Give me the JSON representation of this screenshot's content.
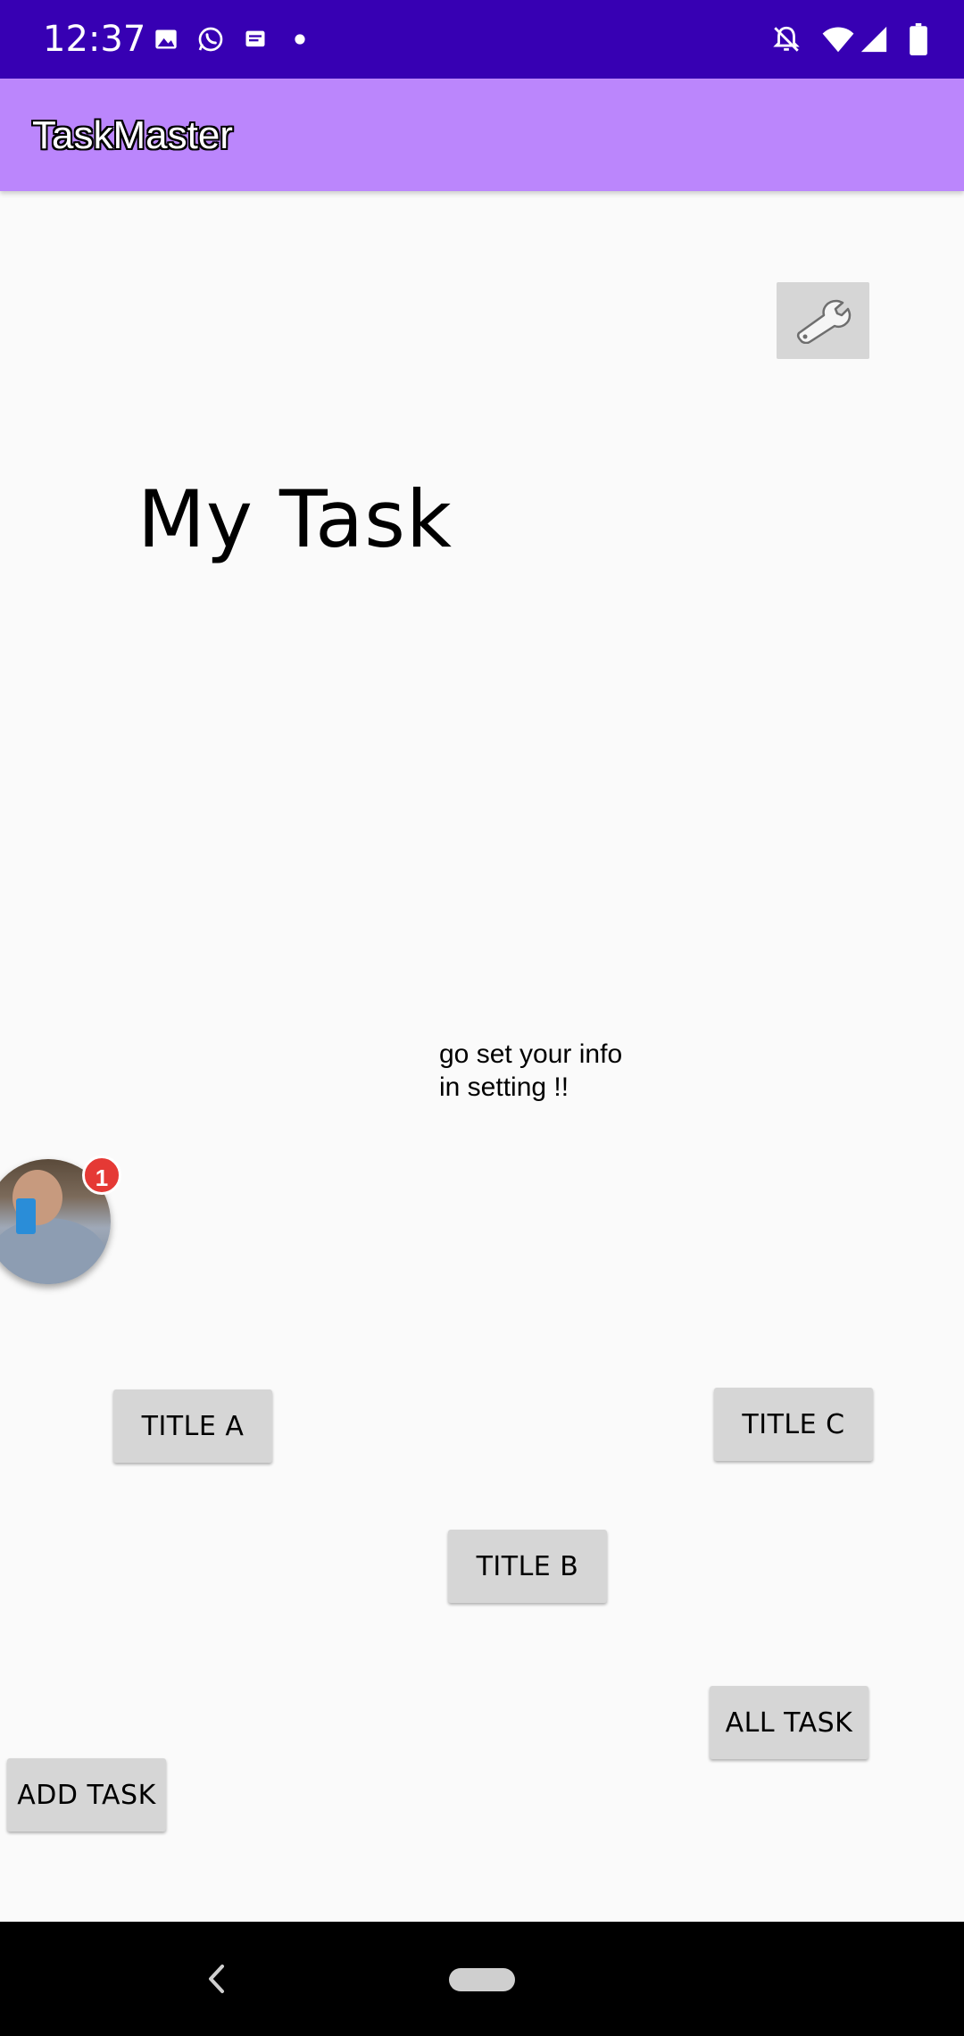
{
  "status_bar": {
    "time": "12:37",
    "left_icons": [
      "image-icon",
      "whatsapp-icon",
      "message-icon",
      "dot-icon"
    ],
    "right_icons": [
      "notifications-off-icon",
      "wifi-icon",
      "signal-icon",
      "battery-icon"
    ],
    "bg_color": "#3700b3"
  },
  "app_bar": {
    "title": "TaskMaster",
    "bg_color": "#bb86fc"
  },
  "main": {
    "settings_icon": "wrench-icon",
    "page_title": "My Task",
    "info_line1": "go set your info",
    "info_line2": "in setting !!",
    "badge_count": "1",
    "buttons": {
      "title_a": "TITLE A",
      "title_b": "TITLE B",
      "title_c": "TITLE C",
      "all_task": "ALL TASK",
      "add_task": "ADD TASK"
    }
  },
  "nav_bar": {
    "back_icon": "back-chevron-icon",
    "home_icon": "home-pill-icon"
  }
}
